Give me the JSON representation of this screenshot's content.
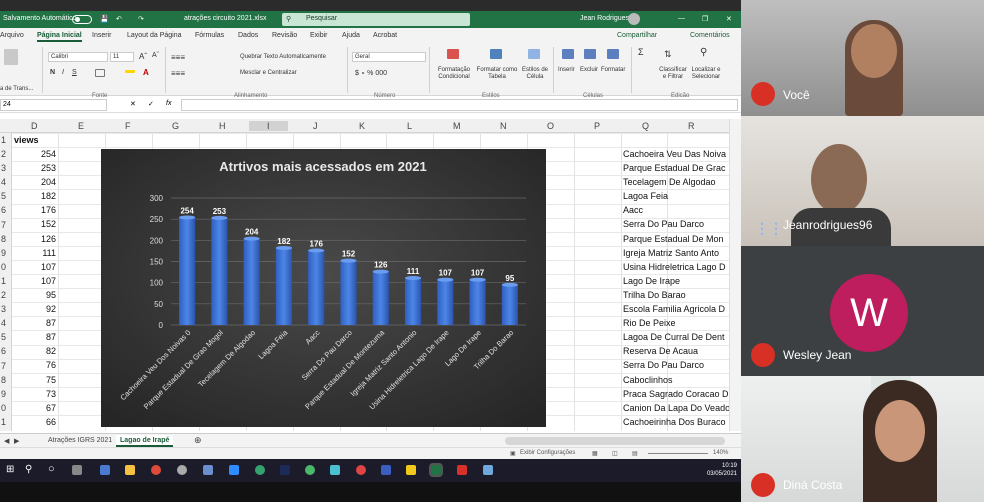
{
  "excel": {
    "titlebar": {
      "autosave_label": "Salvamento Automático",
      "filename": "atrações circuito 2021.xlsx",
      "search_placeholder": "Pesquisar",
      "user_name": "Jean Rodrigues"
    },
    "menu": [
      "Arquivo",
      "Página Inicial",
      "Inserir",
      "Layout da Página",
      "Fórmulas",
      "Dados",
      "Revisão",
      "Exibir",
      "Ajuda",
      "Acrobat"
    ],
    "share_label": "Compartilhar",
    "comments_label": "Comentários",
    "ribbon": {
      "font_name": "Calibri",
      "font_size": "11",
      "wrap_text": "Quebrar Texto Automaticamente",
      "merge_center": "Mesclar e Centralizar",
      "number_format": "Geral",
      "transfer_label": "a de Trans...",
      "groups": [
        "Fonte",
        "Alinhamento",
        "Número",
        "Estilos",
        "Células",
        "Edição"
      ],
      "styles": [
        "Formatação Condicional",
        "Formatar como Tabela",
        "Estilos de Célula"
      ],
      "cells": [
        "Inserir",
        "Excluir",
        "Formatar"
      ],
      "editing": [
        "Classificar e Filtrar",
        "Localizar e Selecionar"
      ]
    },
    "formula_bar": {
      "name_box": "24",
      "fx": "fx"
    },
    "columns": [
      "D",
      "E",
      "F",
      "G",
      "H",
      "I",
      "J",
      "K",
      "L",
      "M",
      "N",
      "O",
      "P",
      "Q",
      "R"
    ],
    "row_numbers": [
      "1",
      "2",
      "3",
      "4",
      "5",
      "6",
      "7",
      "8",
      "9",
      "0",
      "1",
      "2",
      "3",
      "4",
      "5",
      "6",
      "7",
      "8",
      "9",
      "0",
      "1"
    ],
    "views_header": "views",
    "views": [
      "254",
      "253",
      "204",
      "182",
      "176",
      "152",
      "126",
      "111",
      "107",
      "107",
      "95",
      "92",
      "87",
      "87",
      "82",
      "76",
      "75",
      "73",
      "67",
      "66"
    ],
    "attractions": [
      "Cachoeira Veu Das Noiva",
      "Parque Estadual De Grac",
      "Tecelagem De Algodao",
      "Lagoa Feia",
      "Aacc",
      "Serra Do Pau Darco",
      "Parque Estadual De Mon",
      "Igreja Matriz Santo Anto",
      "Usina Hidreletrica Lago D",
      "Lago De Irape",
      "Trilha Do Barao",
      "Escola Familia Agricola D",
      "Rio De Peixe",
      "Lagoa De Curral De Dent",
      "Reserva De Acaua",
      "Serra Do Pau Darco",
      "Caboclinhos",
      "Praca Sagrado Coracao D",
      "Canion Da Lapa Do Veado",
      "Cachoeirinha Dos Buraco"
    ],
    "sheet_tabs": [
      "Atrações IGRS 2021",
      "Lagao de Irapé"
    ],
    "status": {
      "settings": "Exibir Configurações",
      "zoom": "140%"
    },
    "taskbar": {
      "time": "10:19",
      "date": "03/05/2021"
    }
  },
  "chart_data": {
    "type": "bar",
    "title": "Atrtivos mais acessados em 2021",
    "categories": [
      "Cachoeira Veu Dos Noivas 0",
      "Parque Estadual De Grao Mogol",
      "Tecelagem De Algodao",
      "Lagoa Feia",
      "Aacc",
      "Serra Do Pau Darco",
      "Parque Estadual De Montezuma",
      "Igreja Matriz Santo Antonio",
      "Usina Hidreletrica Lago De Irape",
      "Lago De Irape",
      "Trilha Do Barao"
    ],
    "values": [
      254,
      253,
      204,
      182,
      176,
      152,
      126,
      111,
      107,
      107,
      95
    ],
    "yticks": [
      "0",
      "50",
      "100",
      "150",
      "200",
      "250",
      "300"
    ],
    "ylim": [
      0,
      300
    ],
    "grid": true,
    "background": "#3a3a3a",
    "bar_color": "#3b6fd1"
  },
  "meet": {
    "participants": [
      {
        "name": "Você",
        "muted": true
      },
      {
        "name": "Jeanrodrigues96",
        "muted": false
      },
      {
        "name": "Wesley Jean",
        "initial": "W",
        "muted": true
      },
      {
        "name": "Diná Costa",
        "muted": true
      }
    ]
  },
  "colors": {
    "excel_green": "#217346",
    "mic_off": "#d93025",
    "avatar_w": "#be1e5e"
  }
}
